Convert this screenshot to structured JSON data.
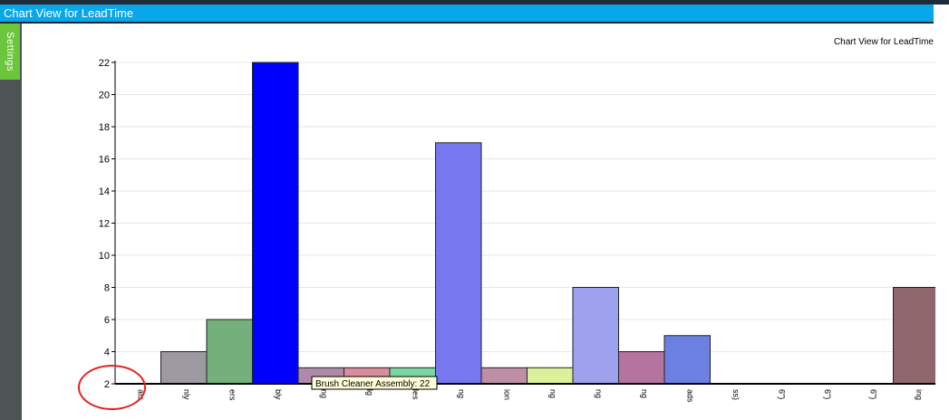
{
  "window": {
    "title": "Chart View for LeadTime"
  },
  "sidebar": {
    "settings_label": "Settings"
  },
  "chart_data": {
    "type": "bar",
    "title": "Chart View for LeadTime",
    "xlabel": "",
    "ylabel": "",
    "ylim": [
      2,
      22
    ],
    "yticks": [
      2,
      4,
      6,
      8,
      10,
      12,
      14,
      16,
      18,
      20,
      22
    ],
    "grid": true,
    "categories": [
      "ats",
      "nly",
      "ers",
      "bly",
      "ng",
      "lg",
      "les",
      "ng",
      "ion",
      "ng",
      "ng",
      "ng",
      "ads",
      "ss)",
      "6\")",
      "6\")",
      "6\")",
      "ing"
    ],
    "values": [
      2,
      4,
      6,
      22,
      3,
      3,
      3,
      17,
      3,
      3,
      8,
      4,
      5,
      2,
      2,
      2,
      2,
      8
    ],
    "colors": [
      "#9c9aa0",
      "#9c9aa0",
      "#73b07a",
      "#0000ff",
      "#ad8aa9",
      "#d98c9c",
      "#77d6a2",
      "#7777f0",
      "#bd8fa6",
      "#dcf09a",
      "#9ea1ee",
      "#b574a0",
      "#6b80e0",
      "#777777",
      "#777777",
      "#777777",
      "#777777",
      "#8e666c"
    ],
    "tooltip": "Brush Cleaner Assembly: 22"
  }
}
